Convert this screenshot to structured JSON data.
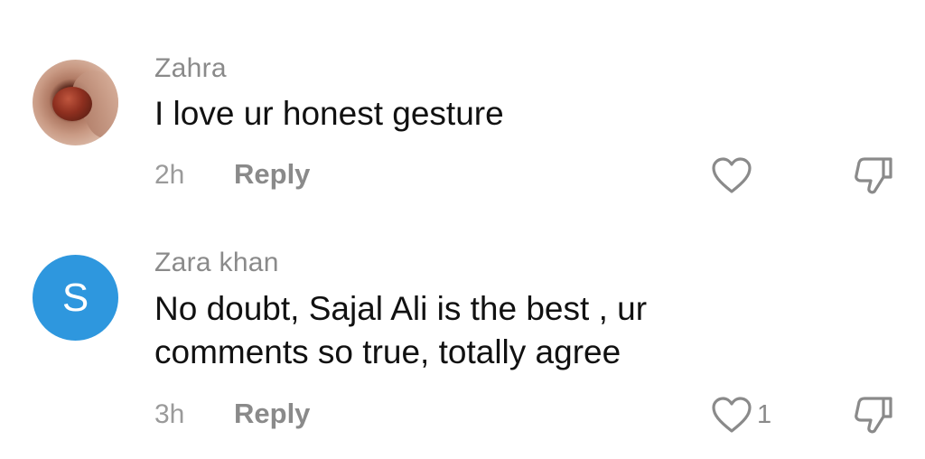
{
  "comments": [
    {
      "username": "Zahra",
      "avatar": {
        "type": "photo",
        "description_icon": "ring-photo-avatar"
      },
      "text": "I love ur honest gesture",
      "time": "2h",
      "reply_label": "Reply",
      "like_count": "",
      "like_icon": "heart-outline-icon",
      "dislike_icon": "thumbs-down-outline-icon"
    },
    {
      "username": "Zara khan",
      "avatar": {
        "type": "letter",
        "letter": "S",
        "color": "#2e97de"
      },
      "text_line1": "No doubt, Sajal Ali is the best , ur",
      "text_line2": "comments so true, totally agree",
      "time": "3h",
      "reply_label": "Reply",
      "like_count": "1",
      "like_icon": "heart-outline-icon",
      "dislike_icon": "thumbs-down-outline-icon"
    }
  ],
  "colors": {
    "username": "#8a8a8a",
    "text": "#111111",
    "meta": "#9a9a9a",
    "icon_stroke": "#8a8a8a",
    "avatar_blue": "#2e97de"
  }
}
